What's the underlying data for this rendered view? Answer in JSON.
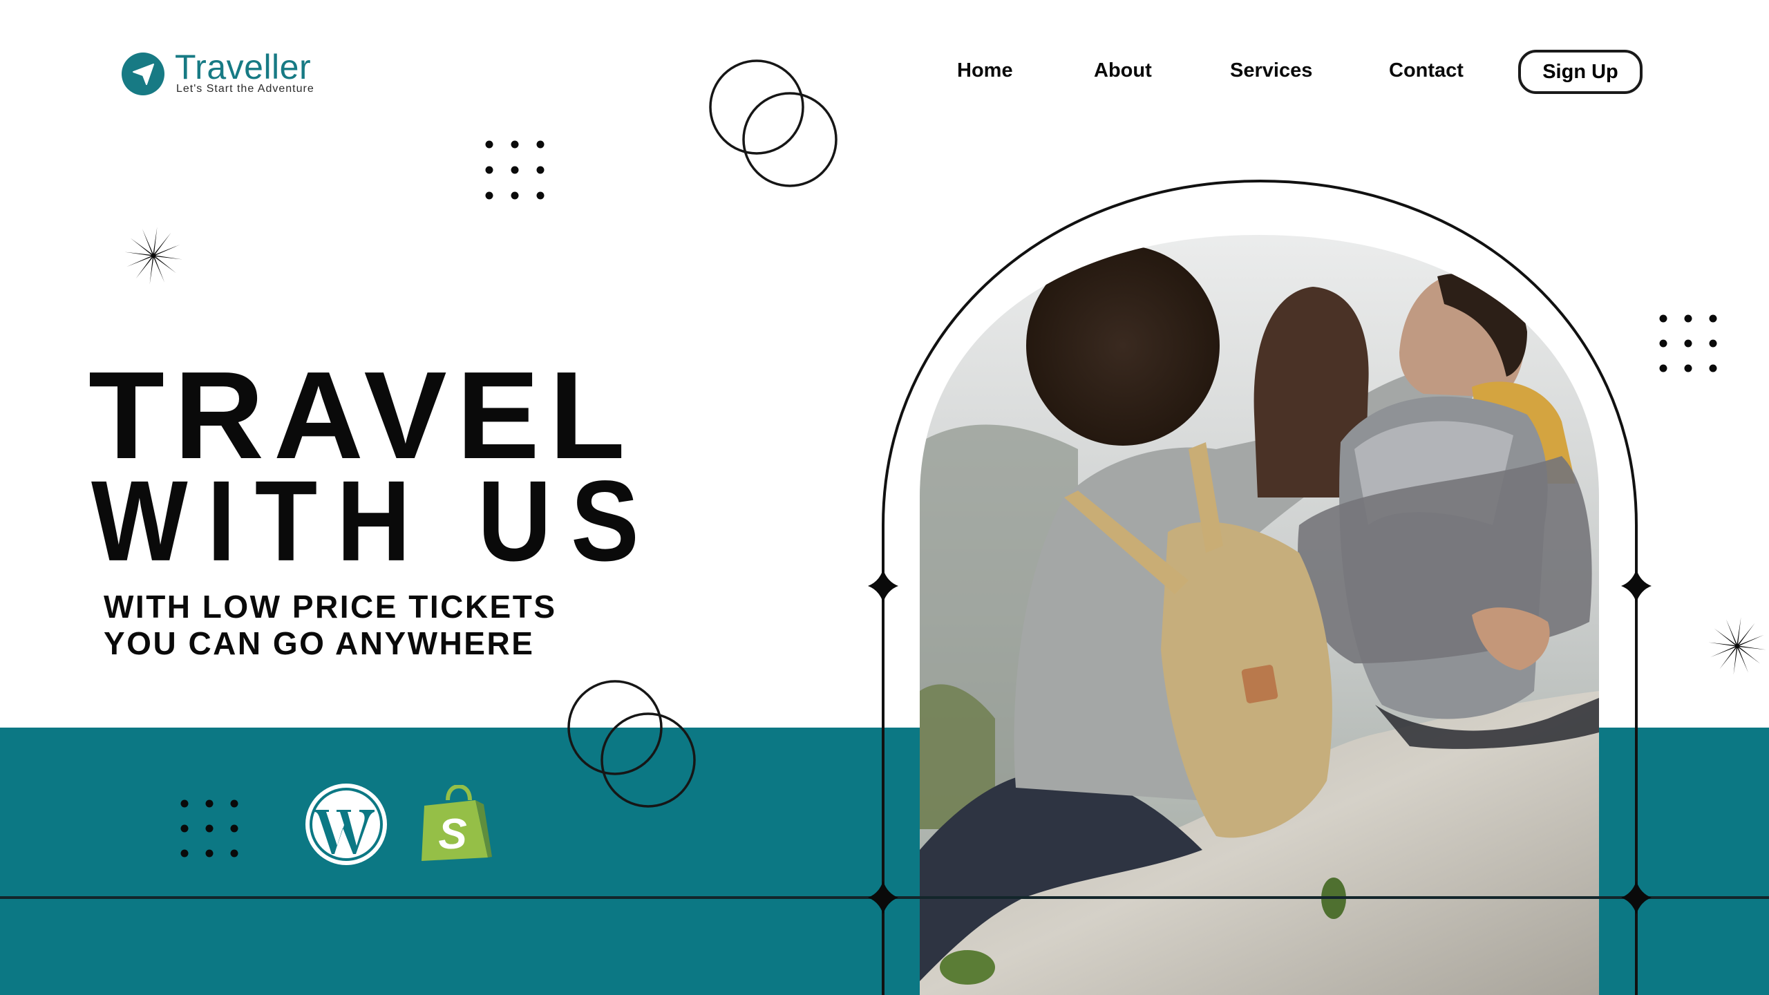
{
  "brand": {
    "name": "Traveller",
    "tagline": "Let's Start the Adventure",
    "color": "#177a84",
    "icon": "navigation-arrow-icon"
  },
  "nav": {
    "items": [
      {
        "label": "Home"
      },
      {
        "label": "About"
      },
      {
        "label": "Services"
      },
      {
        "label": "Contact"
      }
    ],
    "signup_label": "Sign Up"
  },
  "hero": {
    "title_line1": "TRAVEL",
    "title_line2": "WITH US",
    "subtitle_line1": "WITH LOW PRICE TICKETS",
    "subtitle_line2": "YOU CAN GO ANYWHERE",
    "photo_alt": "Three friends with backpacks sitting on a rock overlooking misty mountains"
  },
  "platforms": [
    {
      "name": "WordPress",
      "icon": "wordpress-icon"
    },
    {
      "name": "Shopify",
      "icon": "shopify-icon",
      "letter": "S"
    }
  ],
  "colors": {
    "accent_teal": "#0c7884",
    "text": "#0a0a0a",
    "background": "#ffffff",
    "shopify_green": "#95bf47",
    "shopify_dark": "#5e8e3e"
  }
}
